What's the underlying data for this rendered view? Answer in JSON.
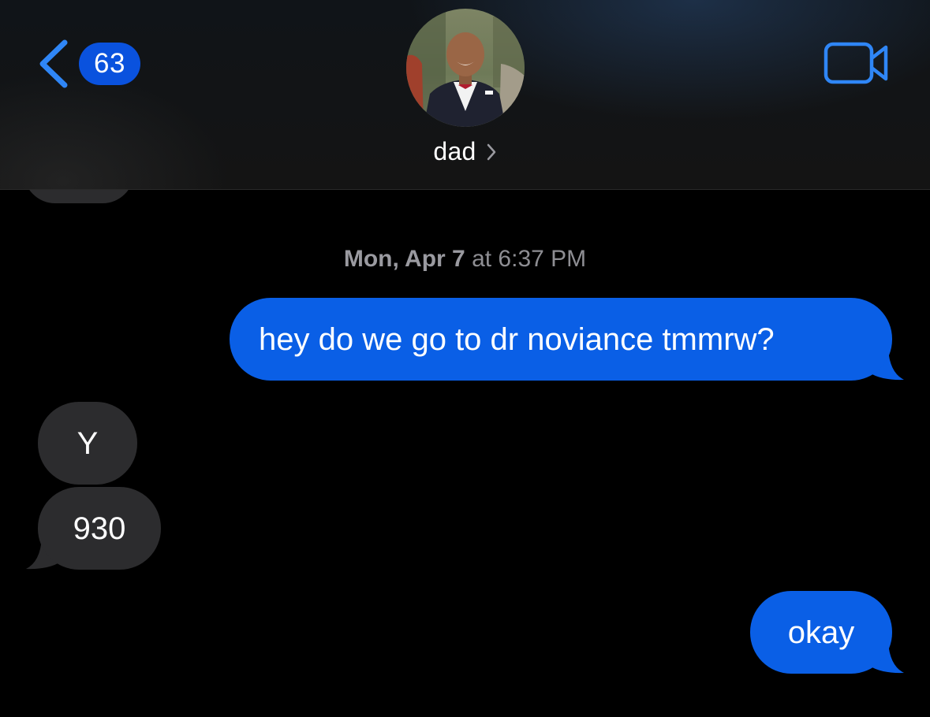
{
  "header": {
    "back_badge_count": "63",
    "contact_name": "dad",
    "colors": {
      "accent": "#2f86f6",
      "badge": "#0a52de"
    },
    "icons": [
      "chevron-left-icon",
      "video-camera-icon",
      "chevron-right-icon"
    ]
  },
  "conversation": {
    "timestamp_day": "Mon, Apr 7",
    "timestamp_rest": "at 6:37 PM",
    "messages": [
      {
        "direction": "sent",
        "text": "hey do we go to dr noviance tmmrw?"
      },
      {
        "direction": "received",
        "text": "Y"
      },
      {
        "direction": "received",
        "text": "930"
      },
      {
        "direction": "sent",
        "text": "okay"
      }
    ],
    "colors": {
      "sent_bubble": "#0a5fe6",
      "received_bubble": "#2c2c2e",
      "background": "#000000"
    }
  }
}
